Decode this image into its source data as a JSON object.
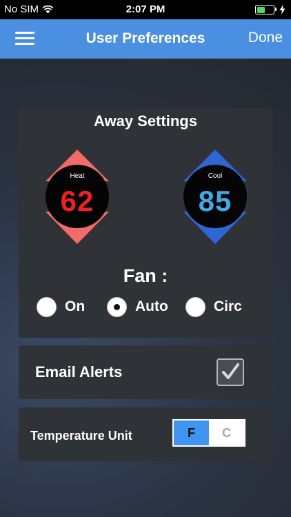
{
  "status_bar": {
    "carrier": "No SIM",
    "time": "2:07 PM",
    "icons": [
      "wifi-icon",
      "battery-icon",
      "charging-bolt-icon"
    ],
    "battery_color": "#4cd964"
  },
  "nav": {
    "title": "User Preferences",
    "done_label": "Done",
    "menu_icon": "hamburger-menu-icon",
    "bar_color": "#4a8fe0"
  },
  "away": {
    "title": "Away Settings",
    "heat": {
      "label": "Heat",
      "value": "62",
      "color": "#f46a6a"
    },
    "cool": {
      "label": "Cool",
      "value": "85",
      "color": "#2f66d6"
    },
    "fan": {
      "title": "Fan :",
      "options": [
        {
          "label": "On",
          "selected": false
        },
        {
          "label": "Auto",
          "selected": true
        },
        {
          "label": "Circ",
          "selected": false
        }
      ]
    }
  },
  "email": {
    "label": "Email Alerts",
    "checked": true
  },
  "unit": {
    "label": "Temperature Unit",
    "options": [
      "F",
      "C"
    ],
    "selected": "F"
  }
}
